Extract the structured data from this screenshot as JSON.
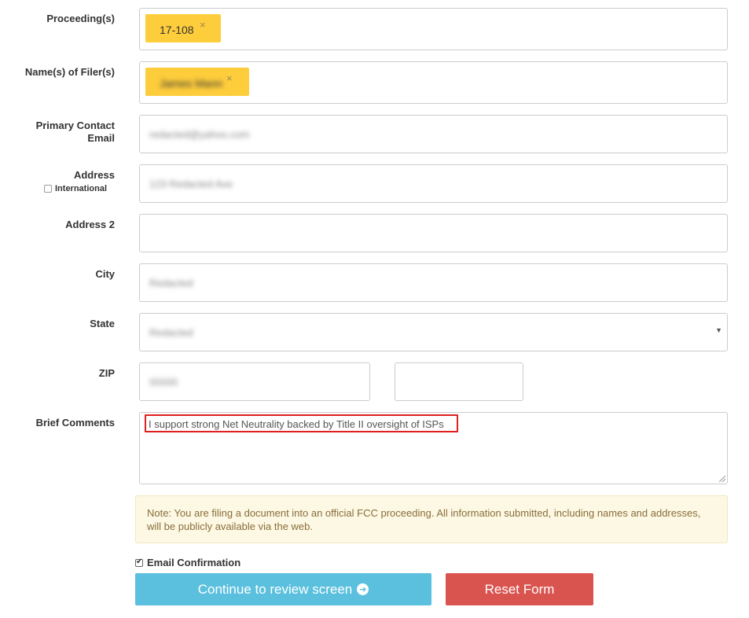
{
  "form": {
    "proceeding": {
      "label": "Proceeding(s)",
      "tags": [
        {
          "text": "17-108",
          "remove": "×"
        }
      ]
    },
    "filer": {
      "label": "Name(s) of Filer(s)",
      "tags": [
        {
          "text": "James Mann",
          "remove": "×"
        }
      ]
    },
    "email": {
      "label_line1": "Primary Contact",
      "label_line2": "Email",
      "value": "redacted@yahoo.com"
    },
    "address": {
      "label": "Address",
      "international_label": "International",
      "value": "123 Redacted Ave"
    },
    "address2": {
      "label": "Address 2",
      "value": ""
    },
    "city": {
      "label": "City",
      "value": "Redacted"
    },
    "state": {
      "label": "State",
      "value": "Redacted",
      "caret": "▼"
    },
    "zip": {
      "label": "ZIP",
      "value": "00000",
      "value_ext": ""
    },
    "comments": {
      "label": "Brief Comments",
      "value": "I support strong Net Neutrality backed by Title II oversight of ISPs"
    },
    "note": "Note: You are filing a document into an official FCC proceeding. All information submitted, including names and addresses, will be publicly available via the web.",
    "email_confirmation": {
      "label": "Email Confirmation",
      "checked": true
    },
    "buttons": {
      "continue_label": "Continue to review screen",
      "reset_label": "Reset Form"
    }
  },
  "colors": {
    "tag_bg": "#fecd3c",
    "continue_bg": "#5bc0de",
    "reset_bg": "#d9534f",
    "note_bg": "#fcf8e3",
    "highlight": "#e02020"
  }
}
